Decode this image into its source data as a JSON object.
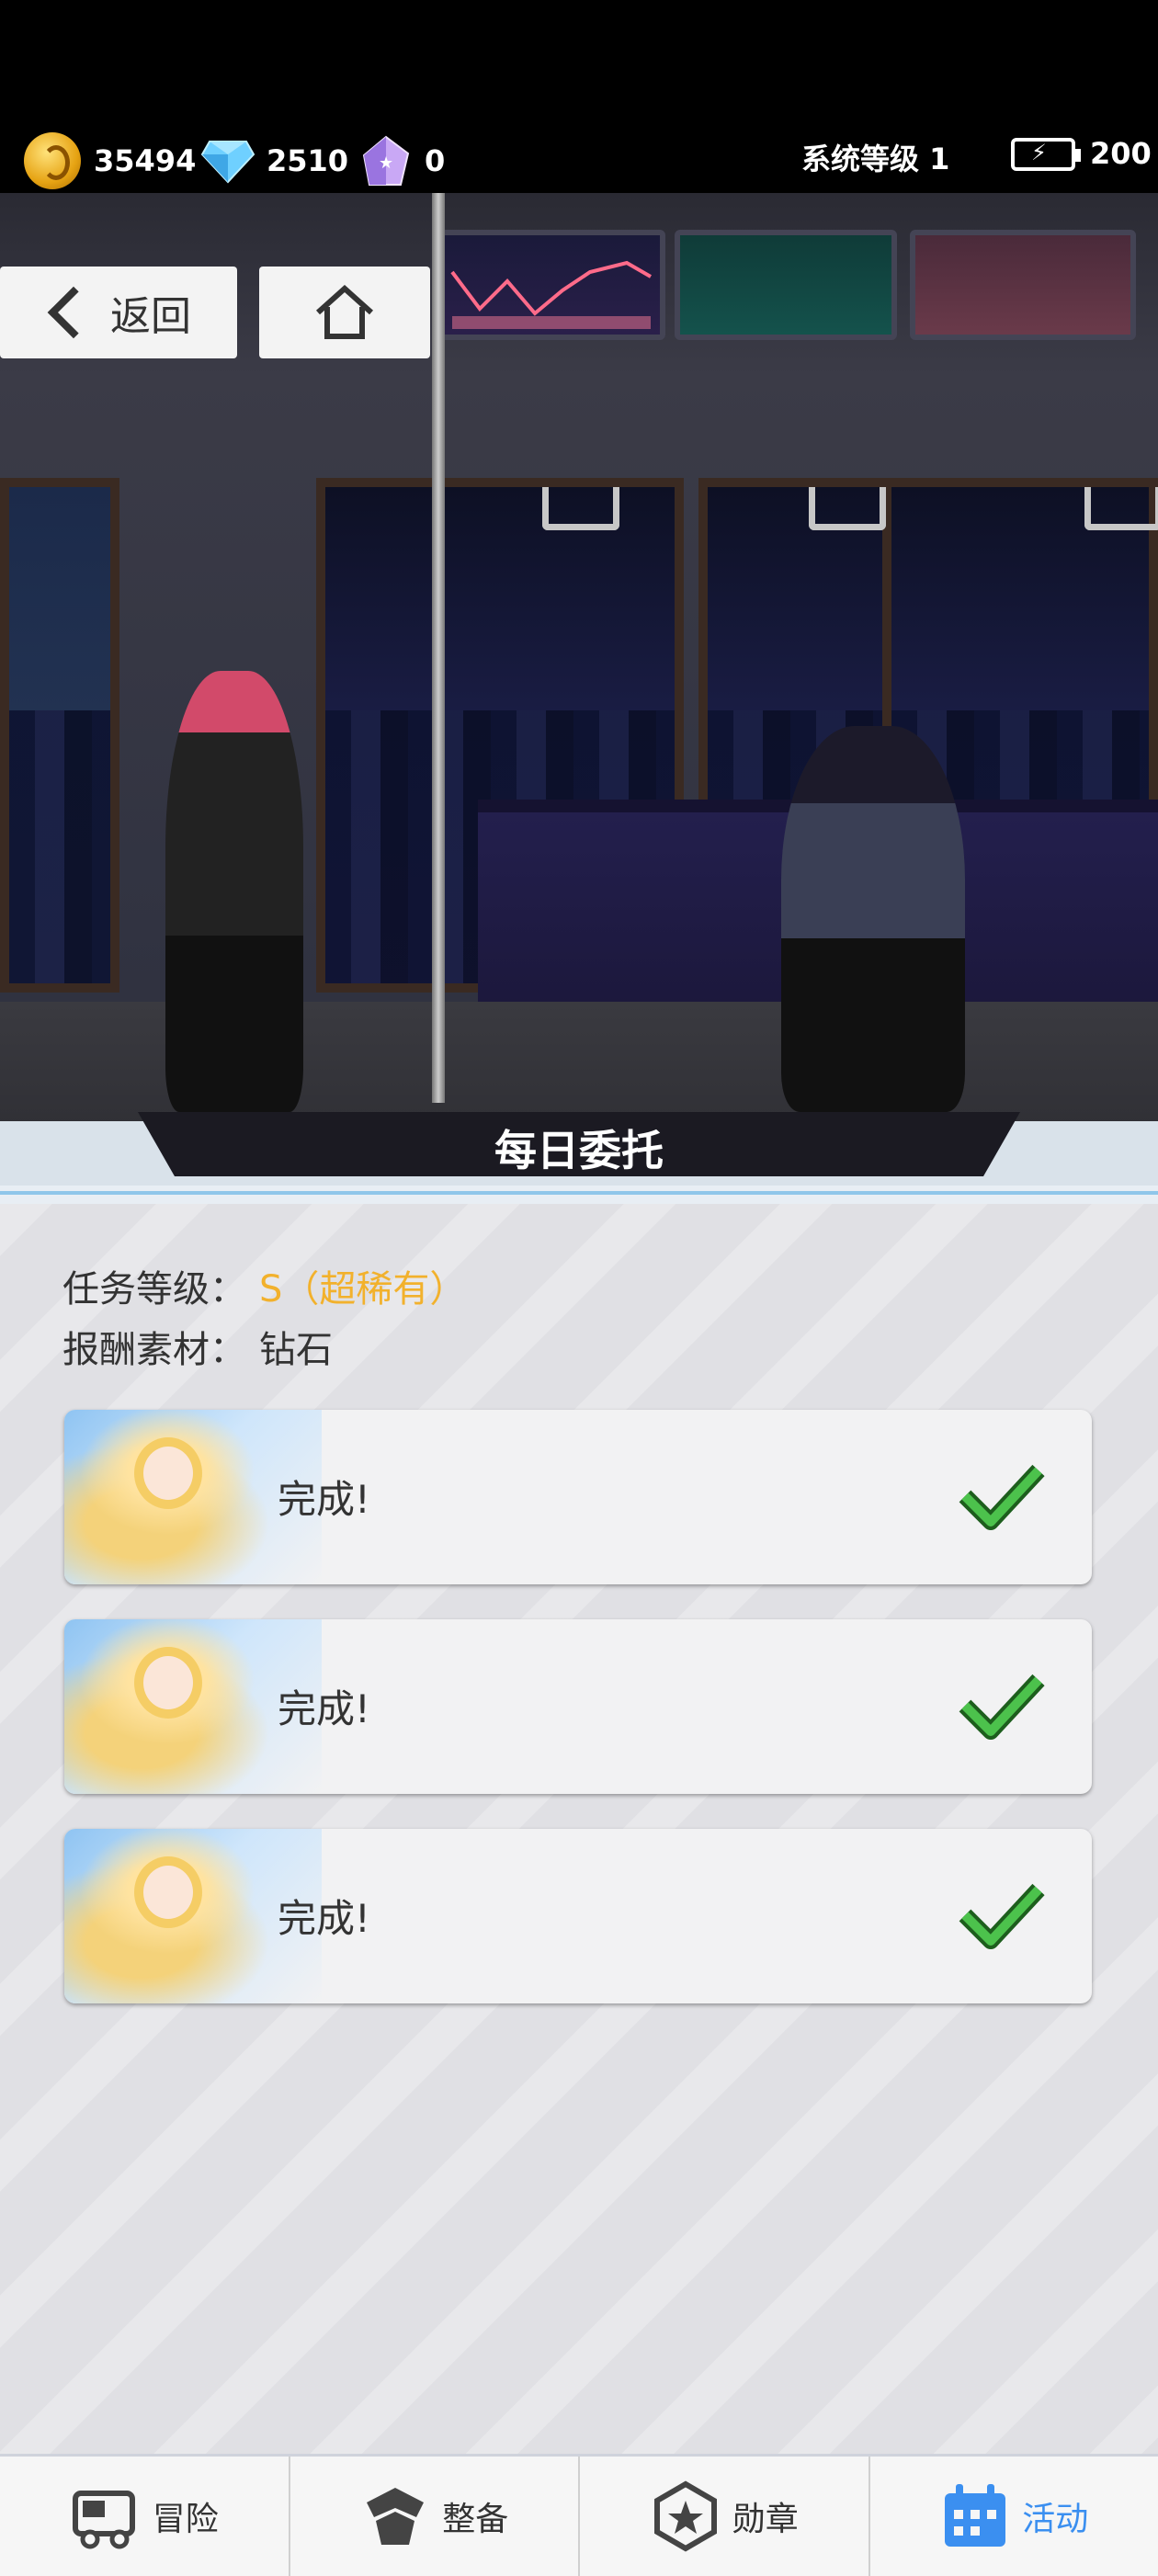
{
  "resources": {
    "gold": "35494",
    "diamond": "2510",
    "shard": "0",
    "system_level": "系统等级 1",
    "energy": "200",
    "icons": [
      "gold-coin-icon",
      "diamond-icon",
      "crystal-shard-icon",
      "battery-icon"
    ]
  },
  "header": {
    "back_label": "返回",
    "home_icon": "home-icon"
  },
  "scene": {
    "title": "每日委托"
  },
  "mission": {
    "level_label": "任务等级：",
    "level_value": "S（超稀有）",
    "reward_label": "报酬素材：",
    "reward_value": "钻石",
    "tasks": [
      {
        "label": "完成!",
        "status": "done"
      },
      {
        "label": "完成!",
        "status": "done"
      },
      {
        "label": "完成!",
        "status": "done"
      }
    ]
  },
  "bottom_nav": {
    "items": [
      {
        "label": "冒险",
        "icon": "truck-icon"
      },
      {
        "label": "整备",
        "icon": "armor-icon"
      },
      {
        "label": "勋章",
        "icon": "medal-icon"
      },
      {
        "label": "活动",
        "icon": "calendar-icon",
        "active": true
      }
    ]
  },
  "colors": {
    "accent": "#3b8ff0",
    "rank": "#f2b12c",
    "check": "#4cc24c"
  }
}
